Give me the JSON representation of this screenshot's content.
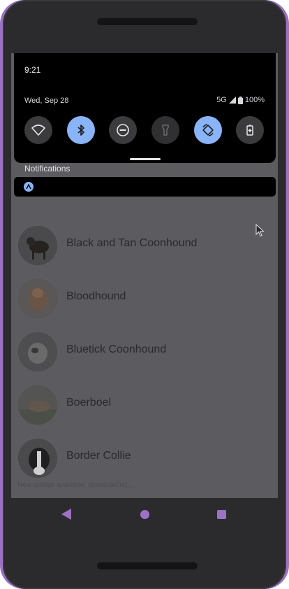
{
  "status": {
    "time": "9:21",
    "date": "Wed, Sep 28",
    "network": "5G",
    "battery": "100%"
  },
  "quick_settings": {
    "tiles": [
      {
        "name": "wifi",
        "state": "off"
      },
      {
        "name": "bluetooth",
        "state": "on"
      },
      {
        "name": "do-not-disturb",
        "state": "off"
      },
      {
        "name": "flashlight",
        "state": "unavailable"
      },
      {
        "name": "auto-rotate",
        "state": "on"
      },
      {
        "name": "battery-saver",
        "state": "off"
      }
    ]
  },
  "notifications": {
    "header": "Notifications"
  },
  "list": {
    "items": [
      {
        "name": "Black and Tan Coonhound"
      },
      {
        "name": "Bloodhound"
      },
      {
        "name": "Bluetick Coonhound"
      },
      {
        "name": "Boerboel"
      },
      {
        "name": "Border Collie"
      }
    ],
    "footer": "New update available, downloading..."
  },
  "colors": {
    "accent": "#8ab4f8",
    "device_frame": "#9c72c4",
    "shade": "#000000",
    "dimmed_background": "#5b5b60"
  }
}
